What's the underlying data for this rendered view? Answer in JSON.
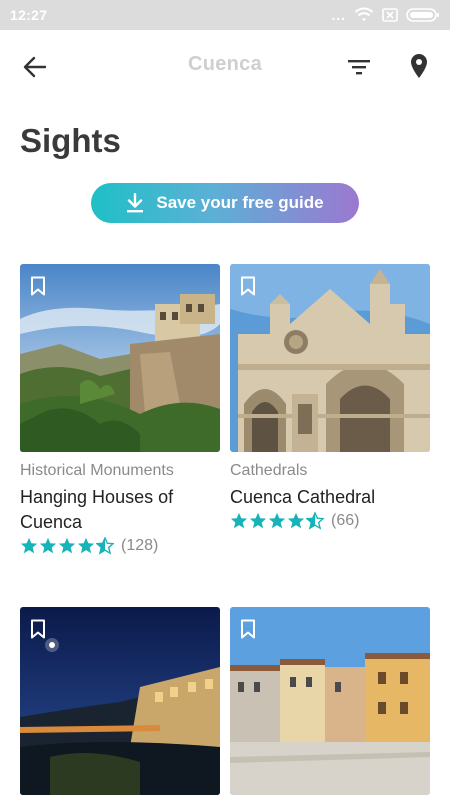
{
  "status_bar": {
    "time": "12:27",
    "dots": "..."
  },
  "app_bar": {
    "title": "Cuenca"
  },
  "page": {
    "title": "Sights"
  },
  "save_guide": {
    "label": "Save your free guide"
  },
  "colors": {
    "accent": "#1ec0c6",
    "accent_end": "#9c78d0",
    "star": "#16b3b8"
  },
  "cards": [
    {
      "category": "Historical Monuments",
      "name": "Hanging Houses of Cuenca",
      "rating": 4.5,
      "rating_count": "(128)"
    },
    {
      "category": "Cathedrals",
      "name": "Cuenca Cathedral",
      "rating": 4.5,
      "rating_count": "(66)"
    },
    {
      "category": "",
      "name": "",
      "rating": null,
      "rating_count": ""
    },
    {
      "category": "",
      "name": "",
      "rating": null,
      "rating_count": ""
    }
  ]
}
